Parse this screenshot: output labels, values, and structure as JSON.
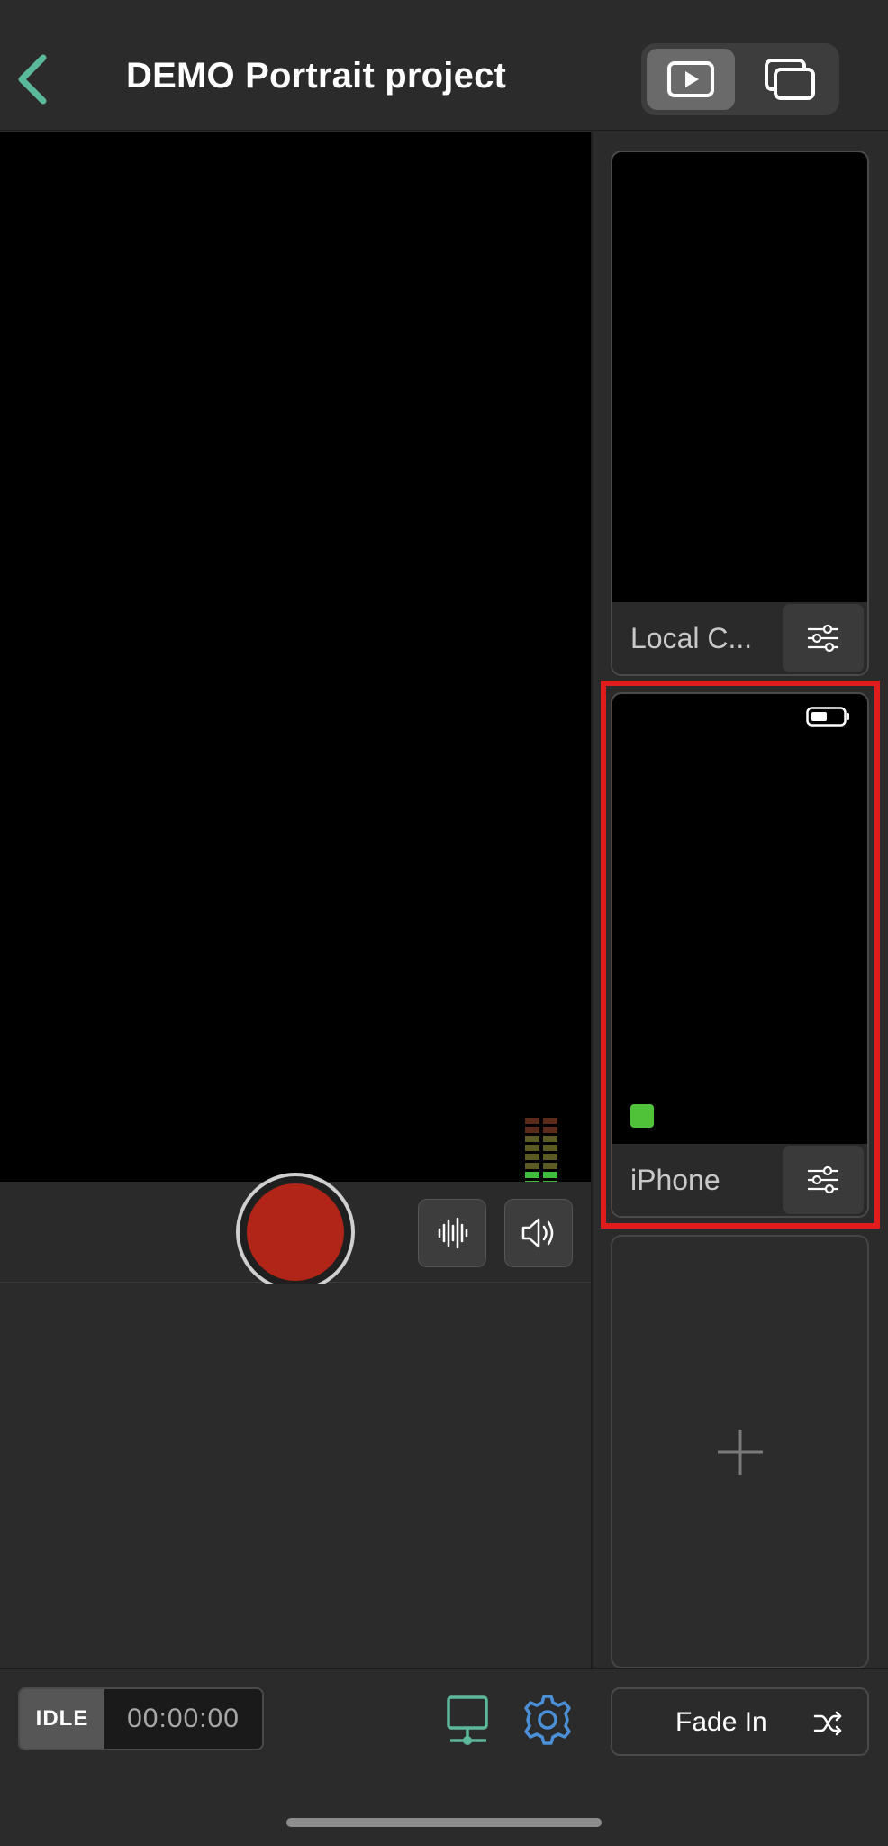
{
  "header": {
    "title": "DEMO Portrait project",
    "back_icon": "chevron-left-icon",
    "accent_color": "#5bb89a",
    "view_toggle": {
      "options": [
        "program-view-icon",
        "multiview-icon"
      ],
      "selected": "program-view-icon"
    }
  },
  "preview": {
    "record_button_color": "#b12418",
    "audio_buttons": [
      "waveform-icon",
      "speaker-icon"
    ]
  },
  "sources": [
    {
      "label": "Local C...",
      "selected": false
    },
    {
      "label": "iPhone",
      "selected": true,
      "has_battery": true,
      "status_color": "#4fc23a"
    }
  ],
  "add_source_icon": "plus-icon",
  "bottom_bar": {
    "status": "IDLE",
    "timecode": "00:00:00",
    "transition_label": "Fade In",
    "icons": [
      "monitor-network-icon",
      "gear-icon",
      "shuffle-icon"
    ],
    "gear_color": "#4a90d9",
    "monitor_color": "#5bb89a"
  }
}
